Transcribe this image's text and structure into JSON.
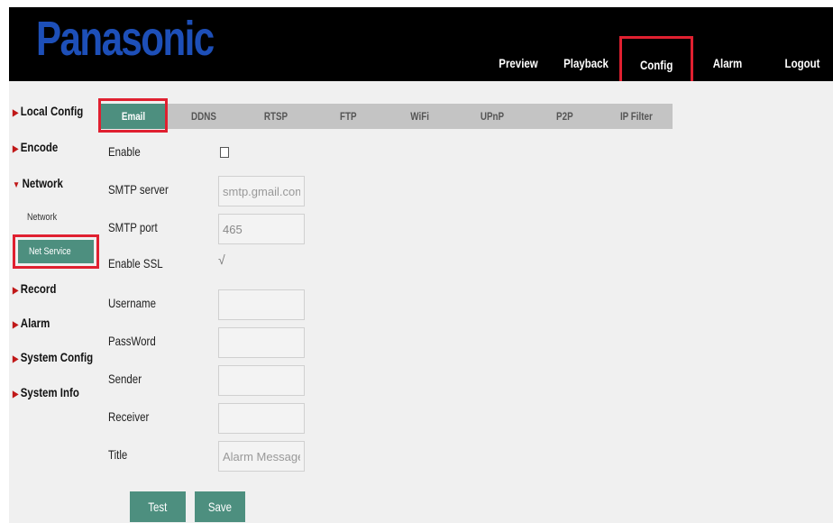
{
  "brand": {
    "logo": "Panasonic",
    "logo_color": "#1d4fb8"
  },
  "nav": {
    "preview": "Preview",
    "playback": "Playback",
    "config": "Config",
    "alarm": "Alarm",
    "logout": "Logout"
  },
  "sidebar": {
    "local_config": "Local Config",
    "encode": "Encode",
    "network": "Network",
    "network_sub": "Network",
    "net_service": "Net Service",
    "record": "Record",
    "alarm": "Alarm",
    "system_config": "System Config",
    "system_info": "System Info",
    "arrow_right": "▶",
    "arrow_down": "▼"
  },
  "tabs": [
    "Email",
    "DDNS",
    "RTSP",
    "FTP",
    "WiFi",
    "UPnP",
    "P2P",
    "IP Filter"
  ],
  "form": {
    "enable_label": "Enable",
    "enable_checked": false,
    "smtp_server_label": "SMTP server",
    "smtp_server_placeholder": "smtp.gmail.com",
    "smtp_port_label": "SMTP port",
    "smtp_port_value": "465",
    "ssl_label": "Enable SSL",
    "ssl_mark": "√",
    "username_label": "Username",
    "password_label": "PassWord",
    "sender_label": "Sender",
    "receiver_label": "Receiver",
    "title_label": "Title",
    "title_placeholder": "Alarm Message"
  },
  "buttons": {
    "test": "Test",
    "save": "Save"
  },
  "colors": {
    "accent": "#4d8f7f",
    "highlight": "#e02030",
    "topbar": "#000000"
  }
}
